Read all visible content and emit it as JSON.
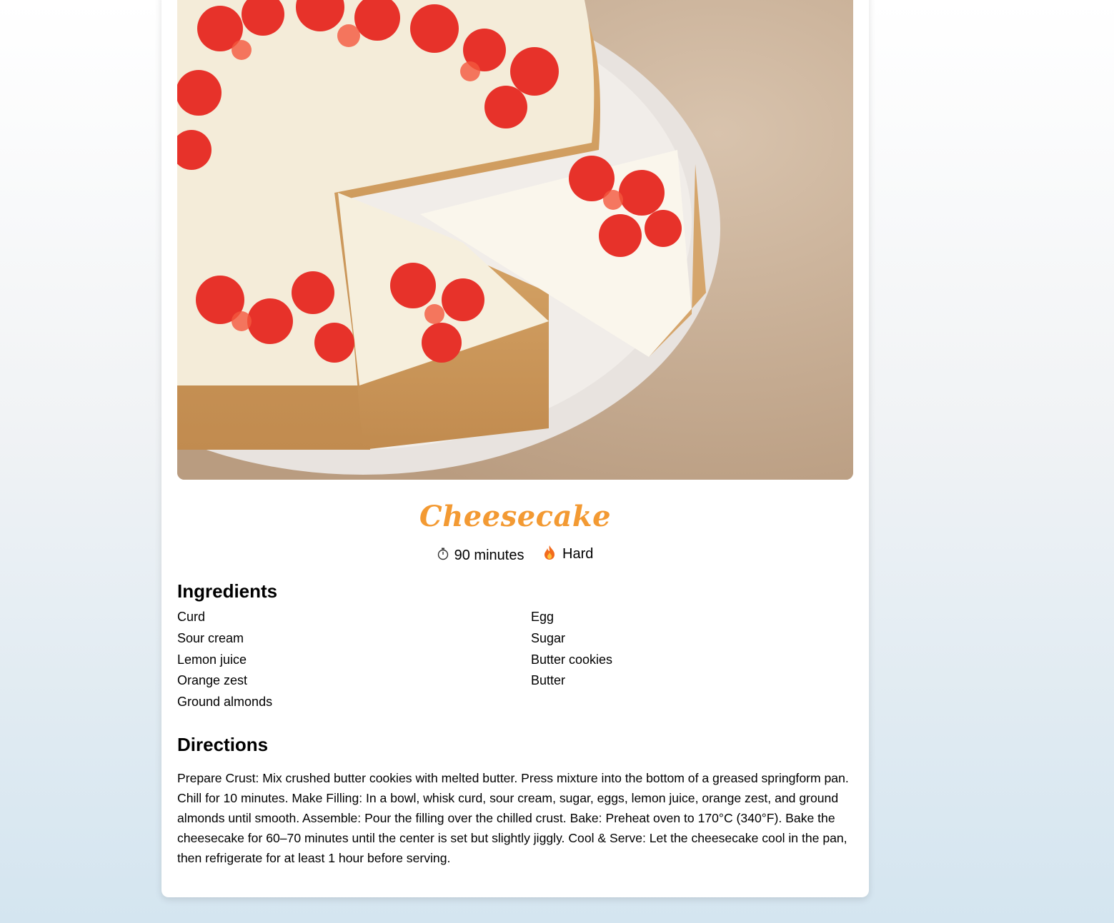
{
  "recipe": {
    "title": "Cheesecake",
    "time": "90 minutes",
    "time_icon": "stopwatch-icon",
    "difficulty": "Hard",
    "difficulty_icon": "fire-icon"
  },
  "ingredients": {
    "heading": "Ingredients",
    "items": [
      "Curd",
      "Sour cream",
      "Lemon juice",
      "Orange zest",
      "Ground almonds",
      "Egg",
      "Sugar",
      "Butter cookies",
      "Butter"
    ]
  },
  "directions": {
    "heading": "Directions",
    "text": "Prepare Crust: Mix crushed butter cookies with melted butter. Press mixture into the bottom of a greased springform pan. Chill for 10 minutes. Make Filling: In a bowl, whisk curd, sour cream, sugar, eggs, lemon juice, orange zest, and ground almonds until smooth. Assemble: Pour the filling over the chilled crust. Bake: Preheat oven to 170°C (340°F). Bake the cheesecake for 60–70 minutes until the center is set but slightly jiggly. Cool & Serve: Let the cheesecake cool in the pan, then refrigerate for at least 1 hour before serving."
  },
  "colors": {
    "title": "#f39a33",
    "card": "#ffffff",
    "background_top": "#ffffff",
    "background_bottom": "#d4e5f0"
  }
}
